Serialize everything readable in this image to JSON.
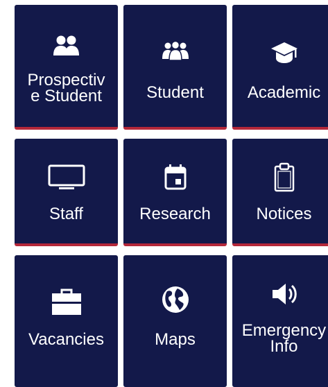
{
  "tiles": [
    {
      "id": "prospective-student",
      "label": "Prospectiv\ne Student",
      "icon": "people-group-icon"
    },
    {
      "id": "student",
      "label": "Student",
      "icon": "users-icon"
    },
    {
      "id": "academic",
      "label": "Academic",
      "icon": "graduation-cap-icon"
    },
    {
      "id": "staff",
      "label": "Staff",
      "icon": "monitor-icon"
    },
    {
      "id": "research",
      "label": "Research",
      "icon": "calendar-icon"
    },
    {
      "id": "notices",
      "label": "Notices",
      "icon": "clipboard-icon"
    },
    {
      "id": "vacancies",
      "label": "Vacancies",
      "icon": "briefcase-icon"
    },
    {
      "id": "maps",
      "label": "Maps",
      "icon": "globe-icon"
    },
    {
      "id": "emergency-info",
      "label": "Emergency\nInfo",
      "icon": "speaker-icon"
    }
  ],
  "colors": {
    "tile_bg": "#13194a",
    "tile_border": "#b5283a",
    "text": "#ffffff"
  }
}
